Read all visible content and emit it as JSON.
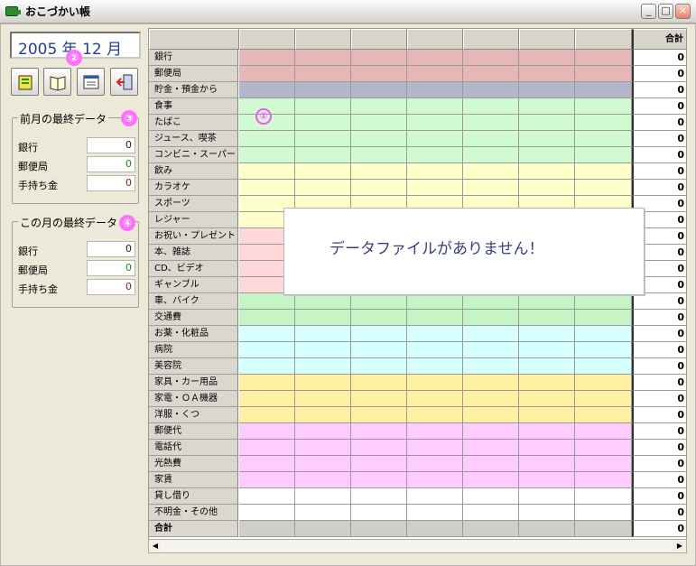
{
  "window": {
    "title": "おこづかい帳",
    "minimize": "_",
    "maximize": "□",
    "close": "×"
  },
  "left_panel": {
    "month": "2005 年 12 月",
    "badges": [
      "①",
      "②",
      "③",
      "④"
    ],
    "prev_group": {
      "title": "前月の最終データ",
      "rows": [
        {
          "label": "銀行",
          "value": "0",
          "color": "#222"
        },
        {
          "label": "郵便局",
          "value": "0",
          "color": "#1b8b1b"
        },
        {
          "label": "手持ち金",
          "value": "0",
          "color": "#8b1b1b"
        }
      ]
    },
    "cur_group": {
      "title": "この月の最終データ",
      "rows": [
        {
          "label": "銀行",
          "value": "0",
          "color": "#222"
        },
        {
          "label": "郵便局",
          "value": "0",
          "color": "#1b8b1b"
        },
        {
          "label": "手持ち金",
          "value": "0",
          "color": "#8b1b1b"
        }
      ]
    }
  },
  "grid": {
    "total_header": "合計",
    "empty_message": "データファイルがありません！",
    "rows": [
      {
        "label": "銀行",
        "total": "0",
        "color": "#e5b7b7"
      },
      {
        "label": "郵便局",
        "total": "0",
        "color": "#e5b7b7"
      },
      {
        "label": "貯金・預金から",
        "total": "0",
        "color": "#b4b6cc"
      },
      {
        "label": "食事",
        "total": "0",
        "color": "#d0fad0"
      },
      {
        "label": "たばこ",
        "total": "0",
        "color": "#d0fad0"
      },
      {
        "label": "ジュース、喫茶",
        "total": "0",
        "color": "#d0fad0"
      },
      {
        "label": "コンビニ・スーパー",
        "total": "0",
        "color": "#d0fad0"
      },
      {
        "label": "飲み",
        "total": "0",
        "color": "#ffffcc"
      },
      {
        "label": "カラオケ",
        "total": "0",
        "color": "#ffffcc"
      },
      {
        "label": "スポーツ",
        "total": "0",
        "color": "#ffffcc"
      },
      {
        "label": "レジャー",
        "total": "0",
        "color": "#ffffcc"
      },
      {
        "label": "お祝い・プレゼント",
        "total": "0",
        "color": "#ffd9d9"
      },
      {
        "label": "本、雑誌",
        "total": "0",
        "color": "#ffd9d9"
      },
      {
        "label": "CD、ビデオ",
        "total": "0",
        "color": "#ffd9d9"
      },
      {
        "label": "ギャンブル",
        "total": "0",
        "color": "#ffd9d9"
      },
      {
        "label": "車、バイク",
        "total": "0",
        "color": "#c5f5c5"
      },
      {
        "label": "交通費",
        "total": "0",
        "color": "#c5f5c5"
      },
      {
        "label": "お薬・化粧品",
        "total": "0",
        "color": "#d6ffff"
      },
      {
        "label": "病院",
        "total": "0",
        "color": "#d6ffff"
      },
      {
        "label": "美容院",
        "total": "0",
        "color": "#d6ffff"
      },
      {
        "label": "家具・カー用品",
        "total": "0",
        "color": "#fff0a3"
      },
      {
        "label": "家電・ＯＡ機器",
        "total": "0",
        "color": "#fff0a3"
      },
      {
        "label": "洋服・くつ",
        "total": "0",
        "color": "#fff0a3"
      },
      {
        "label": "郵便代",
        "total": "0",
        "color": "#ffccff"
      },
      {
        "label": "電話代",
        "total": "0",
        "color": "#ffccff"
      },
      {
        "label": "光熱費",
        "total": "0",
        "color": "#ffccff"
      },
      {
        "label": "家賃",
        "total": "0",
        "color": "#ffccff"
      },
      {
        "label": "貸し借り",
        "total": "0",
        "color": "#ffffff"
      },
      {
        "label": "不明金・その他",
        "total": "0",
        "color": "#ffffff"
      },
      {
        "label": "合計",
        "total": "0",
        "color": "#d0cec8"
      }
    ]
  },
  "scrollbar": {
    "left": "◀",
    "right": "▶"
  }
}
